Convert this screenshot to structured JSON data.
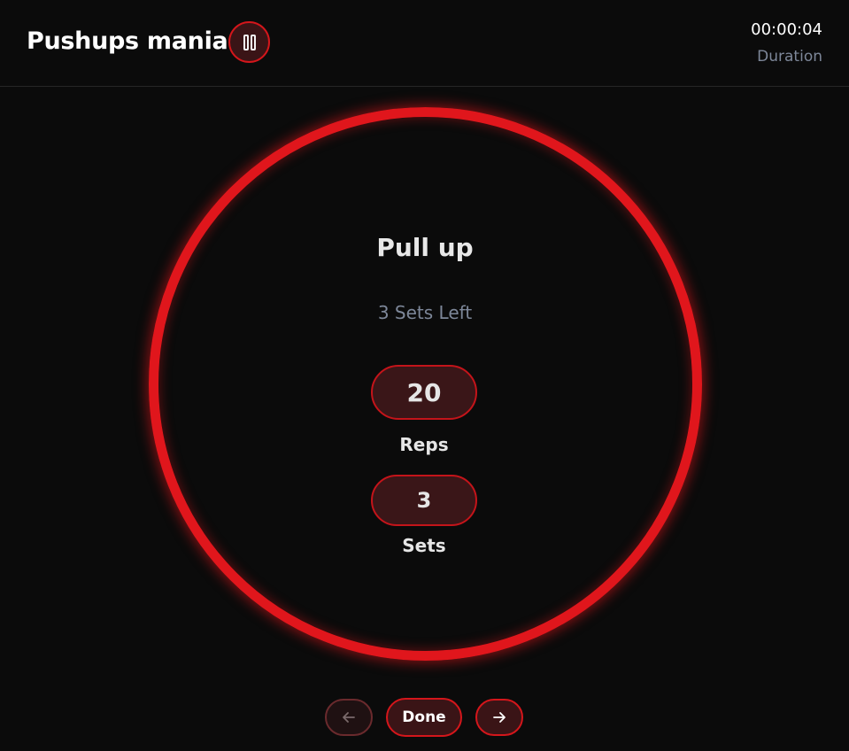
{
  "header": {
    "title": "Pushups mania",
    "pause_icon": "pause-icon",
    "timer_value": "00:00:04",
    "timer_label": "Duration"
  },
  "exercise": {
    "name": "Pull up",
    "sets_left": "3 Sets Left",
    "reps_value": "20",
    "reps_label": "Reps",
    "sets_value": "3",
    "sets_label": "Sets"
  },
  "controls": {
    "prev_icon": "arrow-left-icon",
    "done_label": "Done",
    "next_icon": "arrow-right-icon"
  },
  "colors": {
    "background": "#0b0b0b",
    "accent": "#e0161c",
    "pill_fill": "#3a1618",
    "muted_text": "#7d8799"
  }
}
